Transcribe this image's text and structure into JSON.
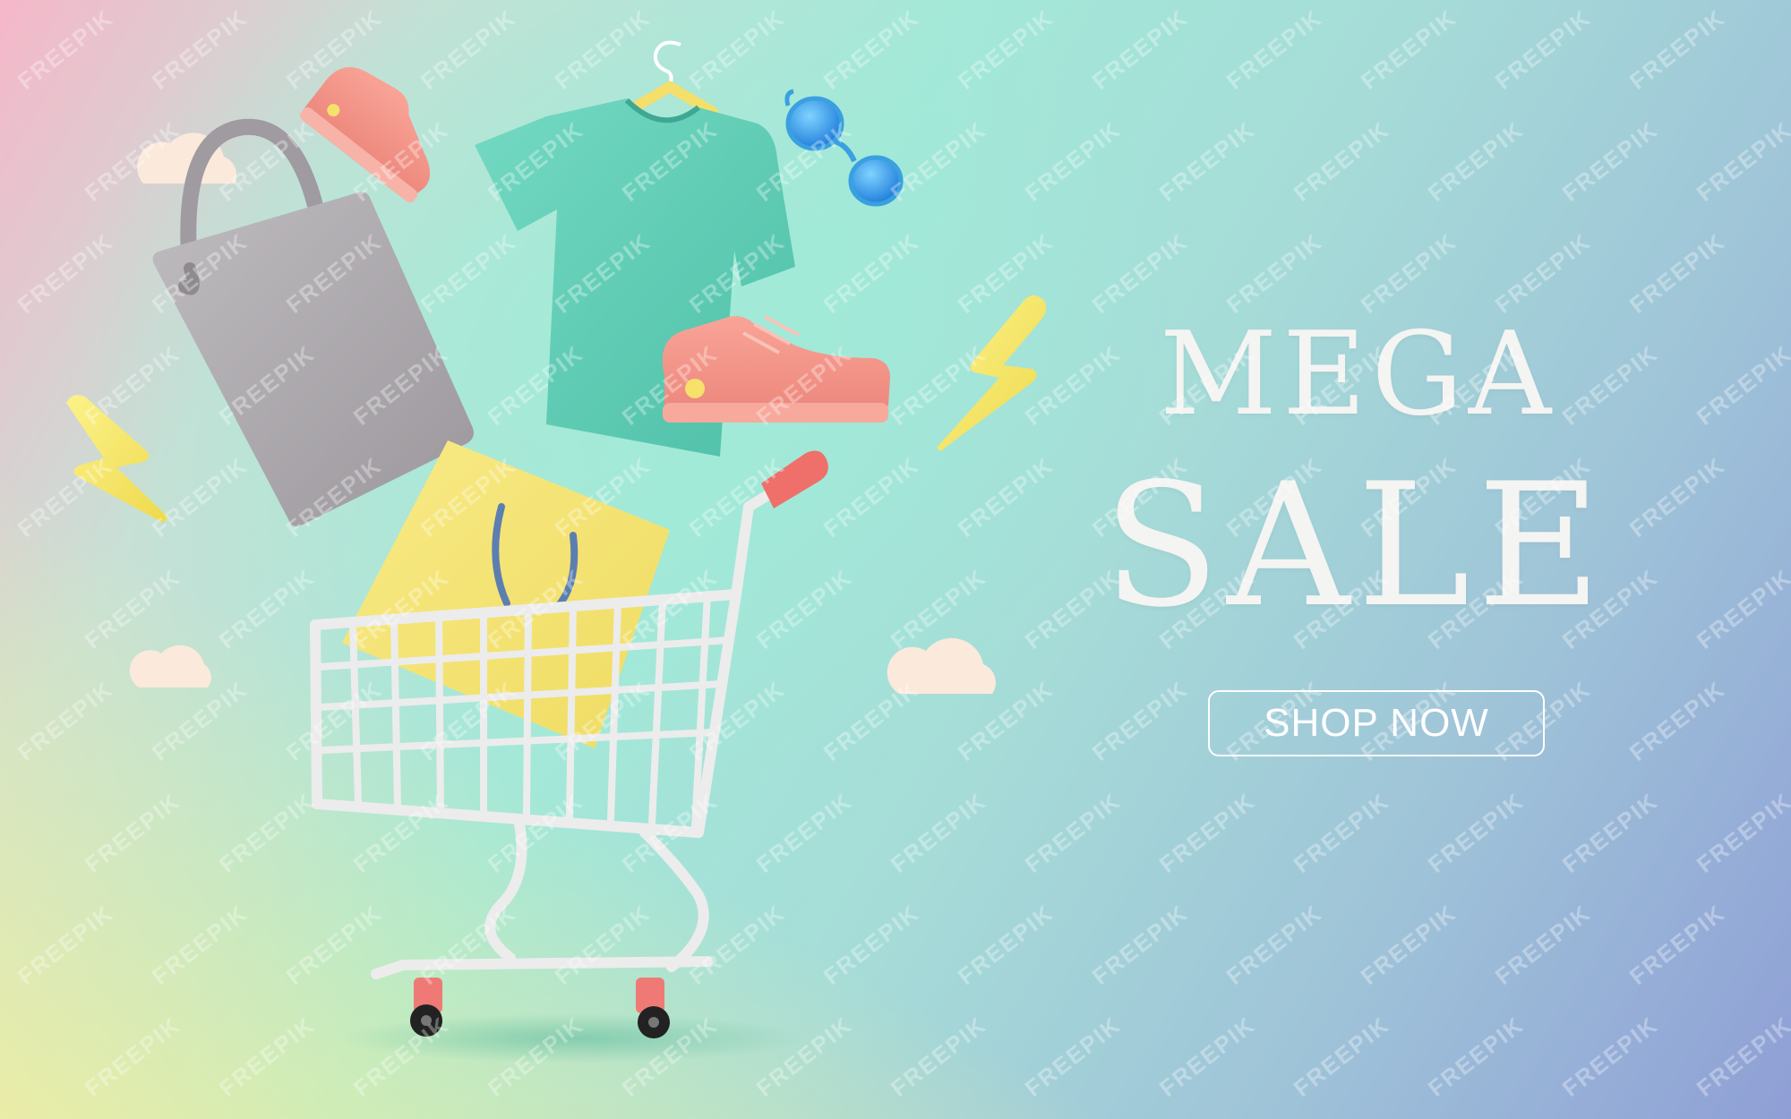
{
  "banner": {
    "headline_line1": "MEGA",
    "headline_line2": "SALE",
    "cta_label": "SHOP NOW",
    "watermark": "FREEPIK"
  },
  "illustration": {
    "objects": [
      "shopping-cart",
      "yellow-shopping-bag",
      "gray-tote-bag",
      "teal-t-shirt-on-hanger",
      "pink-sneaker",
      "pink-sneaker",
      "blue-sunglasses",
      "lightning-bolt",
      "lightning-bolt",
      "cloud",
      "cloud",
      "cloud"
    ]
  },
  "colors": {
    "headline": "#f4f4f2",
    "cta_border": "#ffffff",
    "shirt": "#5ecdb5",
    "sneaker": "#f3958a",
    "bag_yellow": "#f3e57a",
    "tote_gray": "#a9a4a8",
    "bolt": "#f6ea6b",
    "cart": "#eeeeee",
    "cart_handle": "#ef6f6a"
  }
}
